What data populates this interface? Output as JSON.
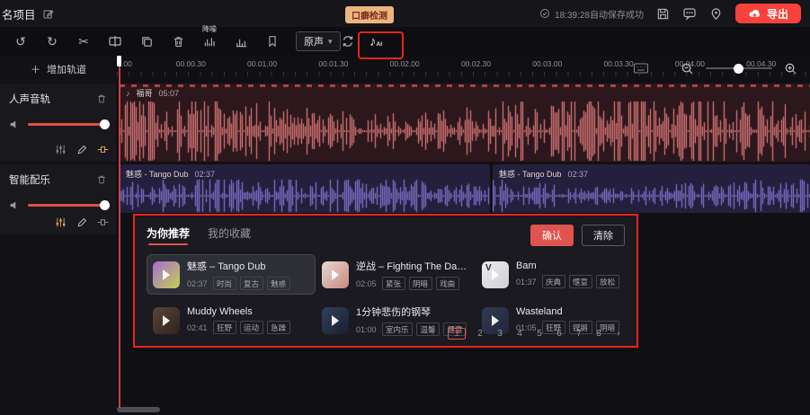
{
  "colors": {
    "accent_red": "#fa413c",
    "annotation_red": "#ea2418",
    "badge_bg": "#ecb57e",
    "confirm_bg": "#e0534e",
    "wave_vocal": "#ef8585",
    "wave_music": "#8d7de0"
  },
  "icons": {
    "undo": "↺",
    "redo": "↻",
    "cut": "✂",
    "note": "♪",
    "caret": "▾",
    "plus": "＋",
    "ai": "AI"
  },
  "topbar": {
    "title": "名项目",
    "badge": "口癖检测",
    "autosave": "18:39:28自动保存成功",
    "export_label": "导出"
  },
  "toolbar": {
    "noise_label": "降噪",
    "source_label": "原声"
  },
  "ruler": {
    "labels": [
      ".00",
      "00.00.30",
      "00.01.00",
      "00.01.30",
      "00.02.00",
      "00.02.30",
      "00.03.00",
      "00.03.30",
      "00.04.00",
      "00.04.30"
    ]
  },
  "sidebar": {
    "add_track": "增加轨道",
    "tracks": [
      {
        "name": "人声音轨"
      },
      {
        "name": "智能配乐"
      }
    ]
  },
  "timeline": {
    "vocal": {
      "label": "福哥",
      "duration": "05:07"
    },
    "music": [
      {
        "label": "魅惑 - Tango Dub",
        "duration": "02:37"
      },
      {
        "label": "魅惑 - Tango Dub",
        "duration": "02:37"
      }
    ]
  },
  "panel": {
    "tabs": [
      {
        "label": "为你推荐"
      },
      {
        "label": "我的收藏"
      }
    ],
    "confirm_label": "确认",
    "clear_label": "清除",
    "items": [
      {
        "title": "魅惑 – Tango Dub",
        "duration": "02:37",
        "tags": [
          "时尚",
          "复古",
          "魅惑"
        ],
        "art": [
          "#a96ad6",
          "#c2d14f"
        ],
        "selected": true
      },
      {
        "title": "逆战 – Fighting The Darkn...",
        "duration": "02:05",
        "tags": [
          "紧张",
          "阴暗",
          "戏曲"
        ],
        "art": [
          "#e6d8d3",
          "#c8887d"
        ]
      },
      {
        "title": "Bam",
        "duration": "01:37",
        "tags": [
          "庆典",
          "惬意",
          "放松"
        ],
        "art": [
          "#ececee",
          "#cfcfd6"
        ],
        "art_label": "V"
      },
      {
        "title": "Muddy Wheels",
        "duration": "02:41",
        "tags": [
          "狂野",
          "运动",
          "急躁"
        ],
        "art": [
          "#5a4436",
          "#2e241e"
        ]
      },
      {
        "title": "1分钟悲伤的钢琴",
        "duration": "01:00",
        "tags": [
          "室内乐",
          "温馨",
          "惬意"
        ],
        "art": [
          "#31415c",
          "#18202e"
        ]
      },
      {
        "title": "Wasteland",
        "duration": "01:05",
        "tags": [
          "狂野",
          "铿锵",
          "阴暗"
        ],
        "art": [
          "#323a52",
          "#20273a"
        ]
      }
    ],
    "pagination": {
      "prev": "‹",
      "pages": [
        "1",
        "2",
        "3",
        "4",
        "5",
        "6",
        "7",
        "8"
      ],
      "active": "1",
      "next": "›"
    }
  }
}
